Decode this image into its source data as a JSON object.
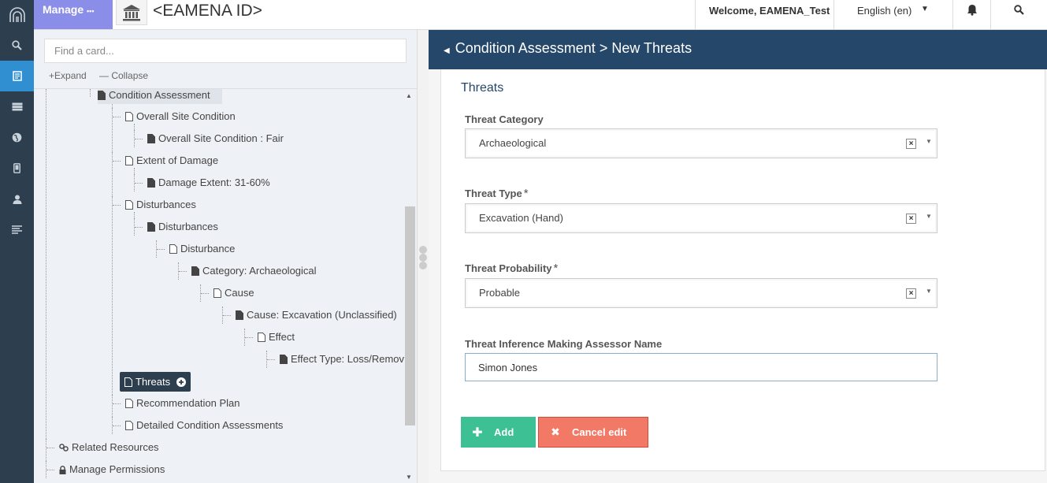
{
  "topbar": {
    "manage_label": "Manage",
    "manage_more": "•••",
    "resource_title": "<EAMENA ID>",
    "welcome": "Welcome, EAMENA_Test",
    "language": "English (en)"
  },
  "leftnav": {
    "icons": [
      "search-icon",
      "resource-editor-icon",
      "database-icon",
      "globe-icon",
      "mobile-icon",
      "user-icon",
      "list-icon"
    ],
    "active": "resource-editor-icon",
    "active_color": "#2f8fd1"
  },
  "tree": {
    "search_placeholder": "Find a card...",
    "expand_label": "Expand",
    "collapse_label": "Collapse",
    "nodes": [
      {
        "label": "Condition Assessment"
      },
      {
        "label": "Overall Site Condition"
      },
      {
        "label": "Overall Site Condition : Fair"
      },
      {
        "label": "Extent of Damage"
      },
      {
        "label": "Damage Extent: 31-60%"
      },
      {
        "label": "Disturbances"
      },
      {
        "label": "Disturbances"
      },
      {
        "label": "Disturbance"
      },
      {
        "label": "Category: Archaeological"
      },
      {
        "label": "Cause"
      },
      {
        "label": "Cause: Excavation (Unclassified)"
      },
      {
        "label": "Effect"
      },
      {
        "label": "Effect Type: Loss/Removal/Destruction"
      },
      {
        "label": "Threats"
      },
      {
        "label": "Recommendation Plan"
      },
      {
        "label": "Detailed Condition Assessments"
      },
      {
        "label": "Related Resources"
      },
      {
        "label": "Manage Permissions"
      }
    ]
  },
  "form": {
    "header_prefix": "Condition Assessment",
    "header_separator": ">",
    "header_title": "New Threats",
    "card_title": "Threats",
    "fields": {
      "category": {
        "label": "Threat Category",
        "value": "Archaeological"
      },
      "type": {
        "label": "Threat Type",
        "required": "*",
        "value": "Excavation (Hand)"
      },
      "probability": {
        "label": "Threat Probability",
        "required": "*",
        "value": "Probable"
      },
      "assessor": {
        "label": "Threat Inference Making Assessor Name",
        "value": "Simon Jones"
      }
    },
    "add_label": "Add",
    "cancel_label": "Cancel edit",
    "colors": {
      "header": "#25476a",
      "add": "#3dc093",
      "cancel": "#f37967"
    }
  }
}
